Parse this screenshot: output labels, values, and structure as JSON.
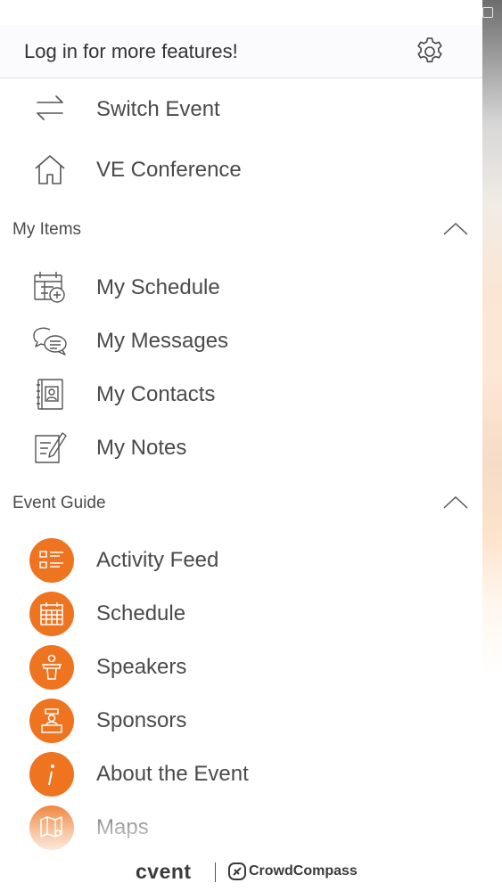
{
  "header": {
    "login_prompt": "Log in for more features!",
    "settings_icon": "gear-icon"
  },
  "top_items": [
    {
      "label": "Switch Event",
      "icon": "switch-arrows-icon"
    },
    {
      "label": "VE Conference",
      "icon": "home-icon"
    }
  ],
  "my_items": {
    "title": "My Items",
    "expanded": true,
    "items": [
      {
        "label": "My Schedule",
        "icon": "calendar-add-icon"
      },
      {
        "label": "My Messages",
        "icon": "chat-bubbles-icon"
      },
      {
        "label": "My Contacts",
        "icon": "contact-book-icon"
      },
      {
        "label": "My Notes",
        "icon": "notes-icon"
      }
    ]
  },
  "event_guide": {
    "title": "Event Guide",
    "expanded": true,
    "items": [
      {
        "label": "Activity Feed",
        "icon": "activity-list-icon"
      },
      {
        "label": "Schedule",
        "icon": "calendar-grid-icon"
      },
      {
        "label": "Speakers",
        "icon": "speaker-podium-icon"
      },
      {
        "label": "Sponsors",
        "icon": "sponsor-podium-icon"
      },
      {
        "label": "About the Event",
        "icon": "info-icon"
      },
      {
        "label": "Maps",
        "icon": "map-icon"
      }
    ]
  },
  "footer": {
    "brand": "cvent",
    "partner": "CrowdCompass"
  },
  "colors": {
    "accent": "#ee7420",
    "text": "#4a4a4a",
    "header_bg": "#fbfafc"
  }
}
